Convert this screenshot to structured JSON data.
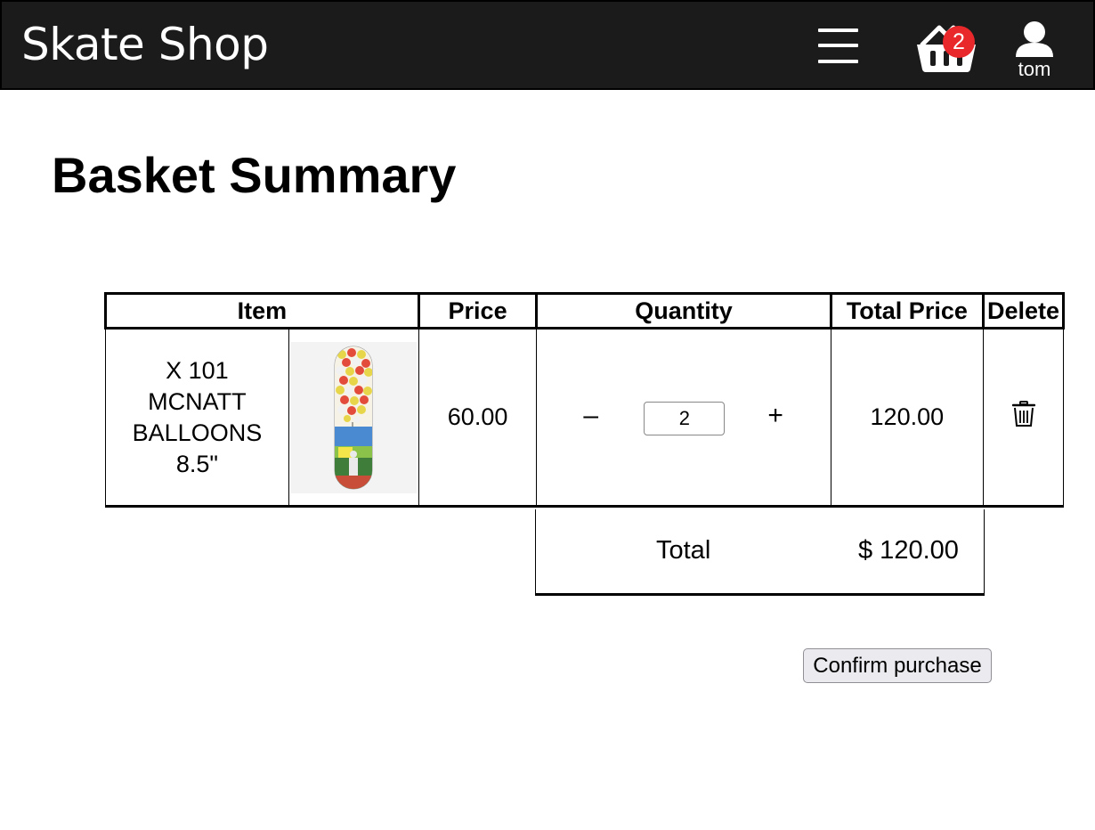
{
  "header": {
    "brand": "Skate Shop",
    "menu_icon": "hamburger-menu-icon",
    "basket_icon": "basket-icon",
    "basket_count": "2",
    "user_icon": "user-icon",
    "username": "tom",
    "background": "#1b1b1b",
    "badge_color": "#e8282b"
  },
  "page": {
    "title": "Basket Summary"
  },
  "table": {
    "headers": {
      "item": "Item",
      "price": "Price",
      "quantity": "Quantity",
      "total_price": "Total Price",
      "delete": "Delete"
    },
    "rows": [
      {
        "name": "X 101 MCNATT BALLOONS 8.5\"",
        "image_icon": "skateboard-deck-image",
        "price": "60.00",
        "quantity": "2",
        "minus": "–",
        "plus": "+",
        "total_price": "120.00",
        "delete_icon": "trash-icon"
      }
    ]
  },
  "summary": {
    "total_label": "Total",
    "total_value": "$ 120.00"
  },
  "actions": {
    "confirm_label": "Confirm purchase"
  }
}
